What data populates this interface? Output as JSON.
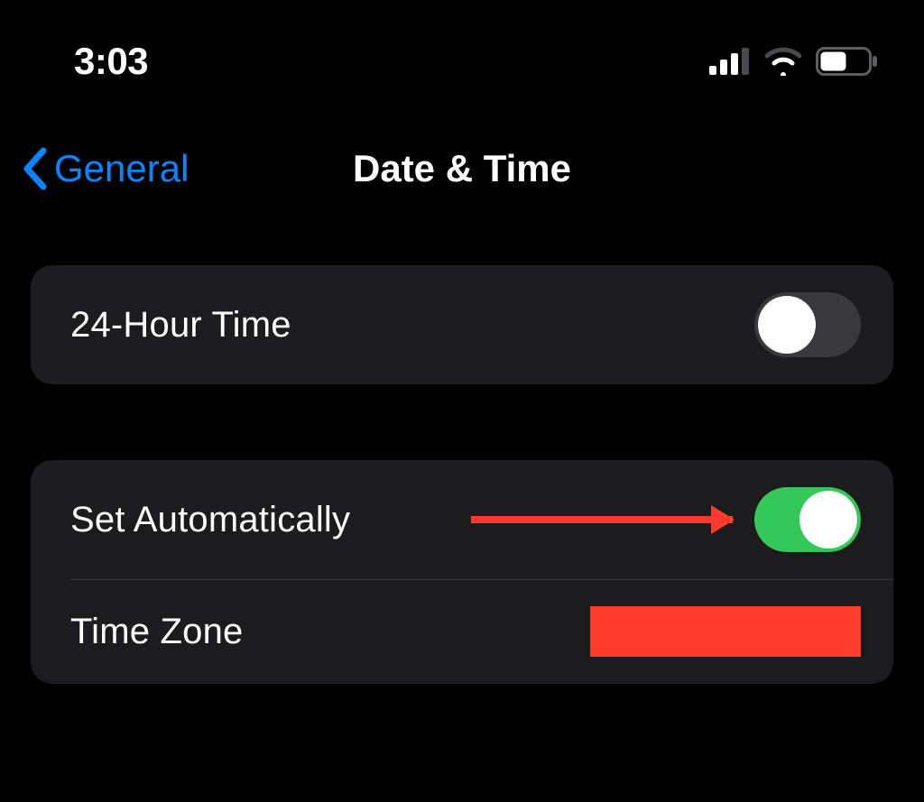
{
  "status": {
    "time": "3:03"
  },
  "nav": {
    "back_label": "General",
    "title": "Date & Time"
  },
  "rows": {
    "twenty_four_hour": {
      "label": "24-Hour Time",
      "on": false
    },
    "set_automatically": {
      "label": "Set Automatically",
      "on": true
    },
    "time_zone": {
      "label": "Time Zone"
    }
  },
  "colors": {
    "accent_blue": "#0a84ff",
    "toggle_on": "#34c759",
    "annotation_red": "#ff3b2f"
  }
}
